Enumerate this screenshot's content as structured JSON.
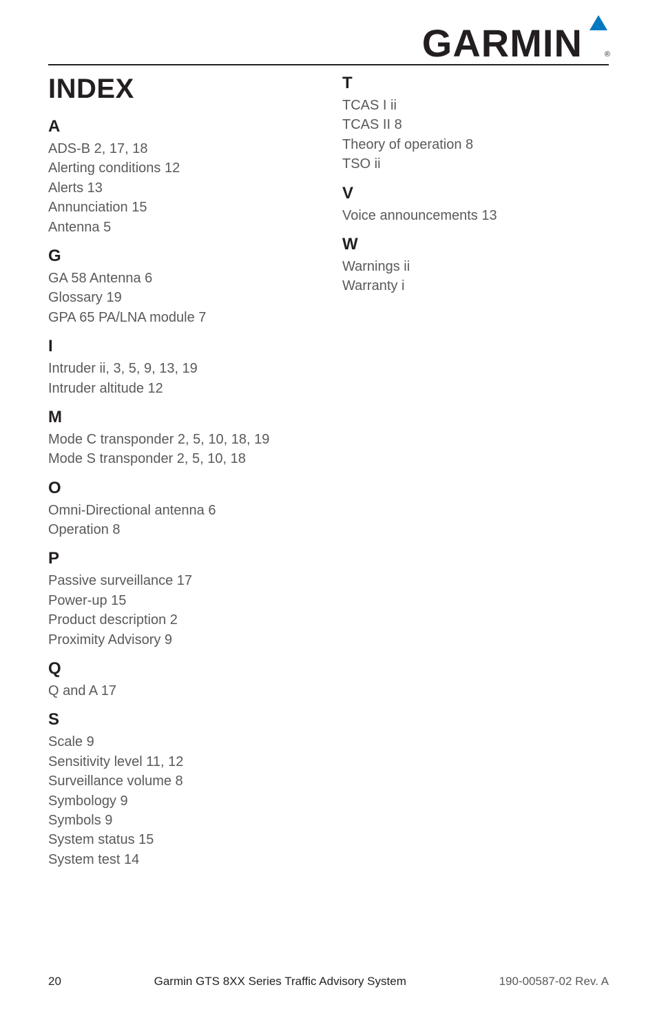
{
  "brand": {
    "name": "GARMIN",
    "accent_color": "#0079c1",
    "reg": "®"
  },
  "title": "INDEX",
  "index": {
    "left": [
      {
        "letter": "A",
        "entries": [
          {
            "text": "ADS-B  2, 17, 18"
          },
          {
            "text": "Alerting conditions  12"
          },
          {
            "text": "Alerts  13"
          },
          {
            "text": "Annunciation  15"
          },
          {
            "text": "Antenna  5"
          }
        ]
      },
      {
        "letter": "G",
        "entries": [
          {
            "text": "GA 58 Antenna  6"
          },
          {
            "text": "Glossary  19"
          },
          {
            "text": "GPA 65 PA/LNA module  7"
          }
        ]
      },
      {
        "letter": "I",
        "entries": [
          {
            "text": "Intruder  ii, 3, 5, 9, 13, 19"
          },
          {
            "text": "Intruder altitude  12"
          }
        ]
      },
      {
        "letter": "M",
        "entries": [
          {
            "text": "Mode C transponder  2, 5, 10, 18, 19"
          },
          {
            "text": "Mode S transponder  2, 5, 10, 18"
          }
        ]
      },
      {
        "letter": "O",
        "entries": [
          {
            "text": "Omni-Directional antenna  6"
          },
          {
            "text": "Operation  8"
          }
        ]
      },
      {
        "letter": "P",
        "entries": [
          {
            "text": "Passive surveillance  17"
          },
          {
            "text": "Power-up  15"
          },
          {
            "text": "Product description  2"
          },
          {
            "text": "Proximity Advisory  9"
          }
        ]
      },
      {
        "letter": "Q",
        "entries": [
          {
            "text": "Q and A  17"
          }
        ]
      },
      {
        "letter": "S",
        "entries": [
          {
            "text": "Scale  9"
          },
          {
            "text": "Sensitivity level  11, 12"
          },
          {
            "text": "Surveillance volume  8"
          },
          {
            "text": "Symbology  9"
          },
          {
            "text": "Symbols  9"
          },
          {
            "text": "System status  15"
          },
          {
            "text": "System test  14"
          }
        ]
      }
    ],
    "right": [
      {
        "letter": "T",
        "entries": [
          {
            "text": "TCAS I  ii"
          },
          {
            "text": "TCAS II  8"
          },
          {
            "text": "Theory of operation  8"
          },
          {
            "text": "TSO  ii"
          }
        ]
      },
      {
        "letter": "V",
        "entries": [
          {
            "text": "Voice announcements  13"
          }
        ]
      },
      {
        "letter": "W",
        "entries": [
          {
            "text": "Warnings  ii"
          },
          {
            "text": "Warranty  i"
          }
        ]
      }
    ]
  },
  "footer": {
    "page": "20",
    "center": "Garmin GTS 8XX Series Traffic Advisory System",
    "right": "190-00587-02  Rev. A"
  }
}
